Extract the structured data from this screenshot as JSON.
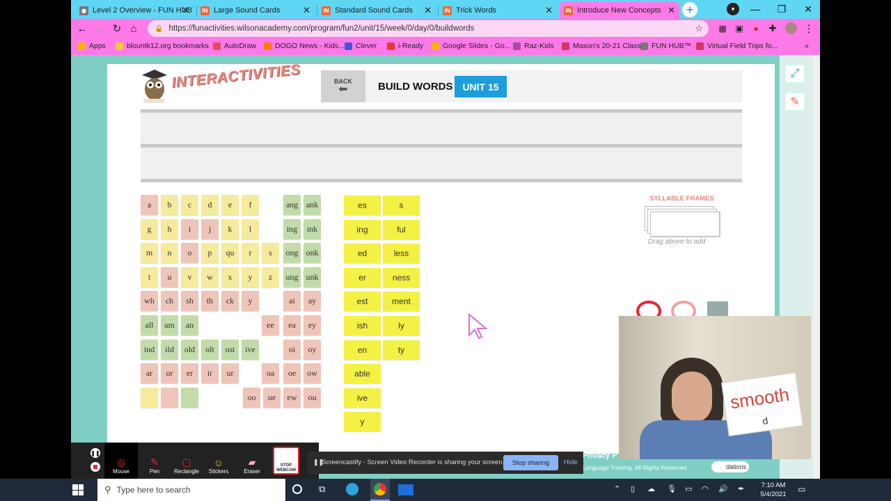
{
  "browser": {
    "tabs": [
      {
        "title": "Level 2 Overview - FUN HUB™",
        "icon_color": "#777"
      },
      {
        "title": "Large Sound Cards",
        "icon_color": "#e86a3a"
      },
      {
        "title": "Standard Sound Cards",
        "icon_color": "#e86a3a"
      },
      {
        "title": "Trick Words",
        "icon_color": "#e86a3a"
      },
      {
        "title": "Introduce New Concepts",
        "icon_color": "#e86a3a",
        "active": true
      }
    ],
    "url": "https://funactivities.wilsonacademy.com/program/fun2/unit/15/week/0/day/0/buildwords",
    "bookmarks": [
      {
        "label": "Apps",
        "color": "#f4b400"
      },
      {
        "label": "blountk12.org bookmarks",
        "color": "#f4c842"
      },
      {
        "label": "AutoDraw",
        "color": "#e84a5f"
      },
      {
        "label": "DOGO News - Kids...",
        "color": "#ff7a00"
      },
      {
        "label": "Clever",
        "color": "#3b5bdb"
      },
      {
        "label": "i-Ready",
        "color": "#e53935"
      },
      {
        "label": "Google Slides - Go...",
        "color": "#f4b400"
      },
      {
        "label": "Raz-Kids",
        "color": "#a64ca6"
      },
      {
        "label": "Mason's 20-21 Class",
        "color": "#d6336c"
      },
      {
        "label": "FUN HUB™",
        "color": "#777"
      },
      {
        "label": "Virtual Field Trips fo...",
        "color": "#d6336c"
      }
    ]
  },
  "app": {
    "logo": "INTERACTIVITIES",
    "back_label": "BACK",
    "title": "BUILD WORDS",
    "unit_badge": "UNIT 15",
    "syllable_frames_label": "SYLLABLE FRAMES",
    "drag_hint": "Drag above to add",
    "footer_link": "Privacy P",
    "footer_text": "Language Training. All Rights Reserved",
    "footer_brand": "dations"
  },
  "letter_tiles": [
    [
      "a",
      "b",
      "c",
      "d",
      "e",
      "f",
      "",
      "ang",
      "ank"
    ],
    [
      "g",
      "h",
      "i",
      "j",
      "k",
      "l",
      "",
      "ing",
      "ink"
    ],
    [
      "m",
      "n",
      "o",
      "p",
      "qu",
      "r",
      "s",
      "ong",
      "onk"
    ],
    [
      "t",
      "u",
      "v",
      "w",
      "x",
      "y",
      "z",
      "ung",
      "unk"
    ],
    [
      "wh",
      "ch",
      "sh",
      "th",
      "ck",
      "y",
      "",
      "ai",
      "ay"
    ],
    [
      "all",
      "am",
      "an",
      "",
      "",
      "",
      "ee",
      "ea",
      "ey"
    ],
    [
      "ind",
      "ild",
      "old",
      "olt",
      "ost",
      "ive",
      "",
      "oi",
      "oy"
    ],
    [
      "ar",
      "or",
      "er",
      "ir",
      "ur",
      "",
      "oa",
      "oe",
      "ow"
    ],
    [
      "",
      "",
      "",
      "",
      "",
      "",
      "oo",
      "ue",
      "ew",
      "ou"
    ]
  ],
  "suffix_tiles": [
    [
      "es",
      "s"
    ],
    [
      "ing",
      "ful"
    ],
    [
      "ed",
      "less"
    ],
    [
      "er",
      "ness"
    ],
    [
      "est",
      "ment"
    ],
    [
      "ish",
      "ly"
    ],
    [
      "en",
      "ty"
    ],
    [
      "able",
      ""
    ],
    [
      "ive",
      ""
    ],
    [
      "y",
      ""
    ]
  ],
  "colors": {
    "pink": "#eec5b8",
    "yellow": "#f6eb9c",
    "green": "#c2dba9",
    "suffix": "#f4f145",
    "badge": "#1a9fdb"
  },
  "webcam": {
    "card_word": "smooth",
    "card_sub": "d"
  },
  "screencastify": {
    "tools": [
      "Mouse",
      "Pen",
      "Rectangle",
      "Stickers",
      "Eraser",
      "STOP WEBCAM"
    ],
    "share_text": "Screencastify - Screen Video Recorder is sharing your screen.",
    "stop_label": "Stop sharing",
    "hide_label": "Hide"
  },
  "taskbar": {
    "search_placeholder": "Type here to search",
    "time": "7:10 AM",
    "date": "5/4/2021"
  }
}
